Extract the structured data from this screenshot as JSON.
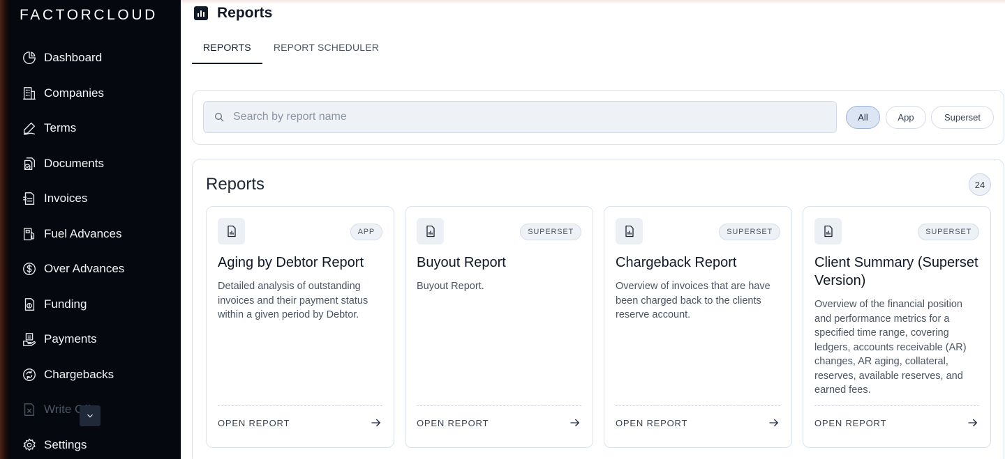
{
  "brand": "FACTORCLOUD",
  "sidebar": {
    "items": [
      {
        "label": "Dashboard",
        "icon": "pie-chart-icon"
      },
      {
        "label": "Companies",
        "icon": "building-icon"
      },
      {
        "label": "Terms",
        "icon": "signature-pen-icon"
      },
      {
        "label": "Documents",
        "icon": "document-check-icon"
      },
      {
        "label": "Invoices",
        "icon": "invoice-icon"
      },
      {
        "label": "Fuel Advances",
        "icon": "fuel-pump-icon"
      },
      {
        "label": "Over Advances",
        "icon": "dollar-circle-icon"
      },
      {
        "label": "Funding",
        "icon": "money-document-icon"
      },
      {
        "label": "Payments",
        "icon": "payments-icon"
      },
      {
        "label": "Chargebacks",
        "icon": "refresh-circle-icon"
      },
      {
        "label": "Write Offs",
        "icon": "document-x-icon"
      },
      {
        "label": "Settings",
        "icon": "gear-icon"
      }
    ],
    "collapse_icon": "chevron-down-icon"
  },
  "header": {
    "title": "Reports",
    "icon": "bar-chart-icon"
  },
  "tabs": [
    {
      "label": "REPORTS",
      "active": true
    },
    {
      "label": "REPORT SCHEDULER",
      "active": false
    }
  ],
  "search": {
    "placeholder": "Search by report name",
    "value": ""
  },
  "filters": [
    {
      "label": "All",
      "active": true
    },
    {
      "label": "App",
      "active": false
    },
    {
      "label": "Superset",
      "active": false
    }
  ],
  "reports": {
    "title": "Reports",
    "count": "24",
    "cards": [
      {
        "kind": "APP",
        "title": "Aging by Debtor Report",
        "description": "Detailed analysis of outstanding invoices and their payment status within a given period by Debtor.",
        "action": "OPEN REPORT"
      },
      {
        "kind": "SUPERSET",
        "title": "Buyout Report",
        "description": "Buyout Report.",
        "action": "OPEN REPORT"
      },
      {
        "kind": "SUPERSET",
        "title": "Chargeback Report",
        "description": "Overview of invoices that are have been charged back to the clients reserve account.",
        "action": "OPEN REPORT"
      },
      {
        "kind": "SUPERSET",
        "title": "Client Summary (Superset Version)",
        "description": "Overview of the financial position and performance metrics for a specified time range, covering ledgers, accounts receivable (AR) changes, AR aging, collateral, reserves, available reserves, and earned fees.",
        "action": "OPEN REPORT"
      }
    ]
  },
  "colors": {
    "sidebar_bg": "#05080f",
    "accent": "#1f2a44",
    "panel_border": "#dbe3ee"
  }
}
